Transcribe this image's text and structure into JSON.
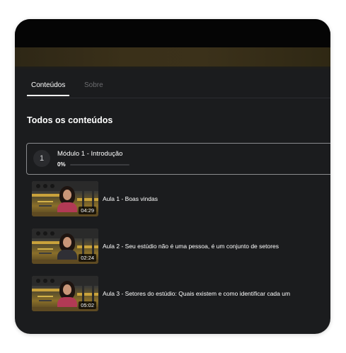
{
  "tabs": [
    {
      "label": "Conteúdos",
      "active": true
    },
    {
      "label": "Sobre",
      "active": false
    }
  ],
  "section_title": "Todos os conteúdos",
  "module": {
    "number": "1",
    "title": "Módulo 1 - Introdução",
    "progress_label": "0%",
    "progress": 0
  },
  "lessons": [
    {
      "title": "Aula 1 - Boas vindas",
      "duration": "04:29"
    },
    {
      "title": "Aula 2 - Seu estúdio não é uma pessoa, é um conjunto de setores",
      "duration": "02:24"
    },
    {
      "title": "Aula 3 - Setores do estúdio: Quais existem e como identificar cada um",
      "duration": "05:02"
    }
  ],
  "colors": {
    "background": "#1b1c1e",
    "text": "#ffffff",
    "muted_text": "#6c6d70",
    "border": "#8a8b8e",
    "accent": "#c9a23b"
  }
}
